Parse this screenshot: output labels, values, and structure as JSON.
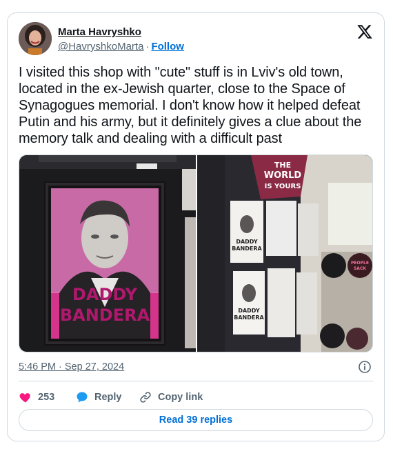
{
  "author": {
    "name": "Marta Havryshko",
    "handle": "@HavryshkoMarta",
    "separator": "·",
    "follow_label": "Follow"
  },
  "tweet": {
    "text": "I visited this shop with \"cute\" stuff is in Lviv's old town, located in the ex-Jewish quarter, close to the Space of Synagogues memorial. I don't know how it helped defeat Putin and his army, but it definitely gives a clue about the memory talk and dealing with a difficult past"
  },
  "media": {
    "left_photo_text": [
      "DADDY",
      "BANDERA"
    ],
    "right_photo_text": {
      "bag_lines": [
        "THE",
        "WORLD",
        "IS YOURS"
      ],
      "sock_labels": [
        "DADDY",
        "BANDERA"
      ],
      "sign_text": [
        "PEOPLE",
        "SACK"
      ]
    }
  },
  "meta": {
    "timestamp": "5:46 PM · Sep 27, 2024"
  },
  "actions": {
    "like_count": "253",
    "reply_label": "Reply",
    "copy_label": "Copy link"
  },
  "footer": {
    "read_replies_label": "Read 39 replies"
  },
  "colors": {
    "like": "#f91880",
    "reply": "#1d9bf0",
    "link": "#006fd6",
    "muted": "#536471"
  },
  "icons": [
    "x-logo-icon",
    "info-icon",
    "heart-icon",
    "reply-bubble-icon",
    "link-icon"
  ]
}
